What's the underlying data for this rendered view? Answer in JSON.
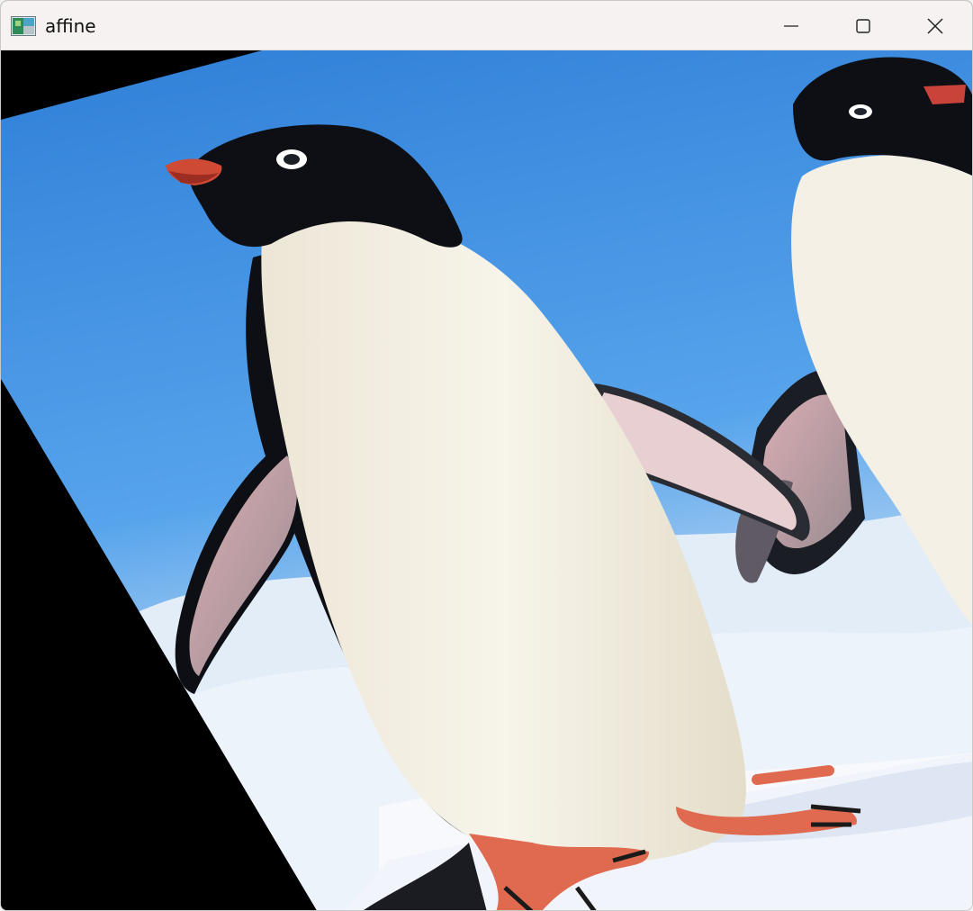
{
  "window": {
    "title": "affine",
    "icons": {
      "app": "opencv-window-icon",
      "minimize": "minimize-icon",
      "maximize": "maximize-icon",
      "close": "close-icon"
    }
  },
  "content": {
    "image": "penguins-affine-transformed",
    "colors": {
      "sky": "#3e8ee0",
      "snow": "#eef3fb",
      "penguin_black": "#0d0f14",
      "belly": "#f3f0e4",
      "beak": "#d44a37",
      "feet": "#e06a4f",
      "background": "#000000"
    }
  }
}
